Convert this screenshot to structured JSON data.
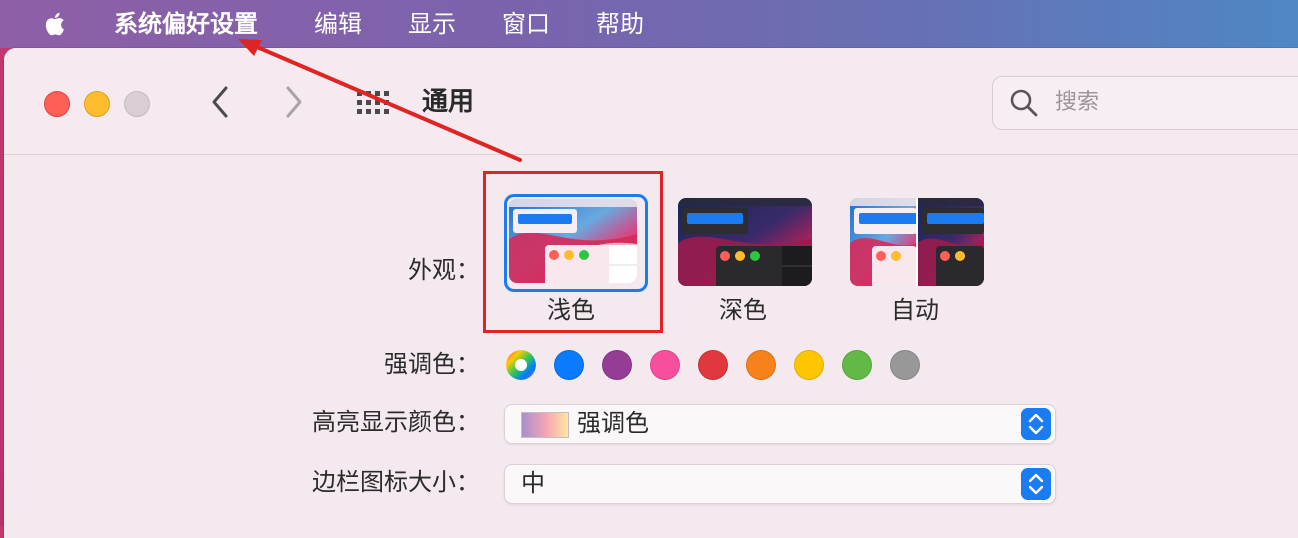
{
  "menubar": {
    "app_name": "系统偏好设置",
    "items": [
      "编辑",
      "显示",
      "窗口",
      "帮助"
    ]
  },
  "toolbar": {
    "title": "通用",
    "search_placeholder": "搜索"
  },
  "appearance": {
    "label": "外观：",
    "options": [
      {
        "name": "浅色",
        "selected": true
      },
      {
        "name": "深色",
        "selected": false
      },
      {
        "name": "自动",
        "selected": false
      }
    ]
  },
  "accent": {
    "label": "强调色：",
    "colors": [
      "multicolor",
      "#0a7aff",
      "#953d96",
      "#f74f9e",
      "#e0383e",
      "#f7821b",
      "#ffc600",
      "#62ba46",
      "#989898"
    ]
  },
  "highlight": {
    "label": "高亮显示颜色：",
    "value": "强调色"
  },
  "sidebar_icon": {
    "label": "边栏图标大小：",
    "value": "中"
  },
  "annotation": {
    "box_color": "#e02424",
    "arrow_color": "#e02424"
  }
}
